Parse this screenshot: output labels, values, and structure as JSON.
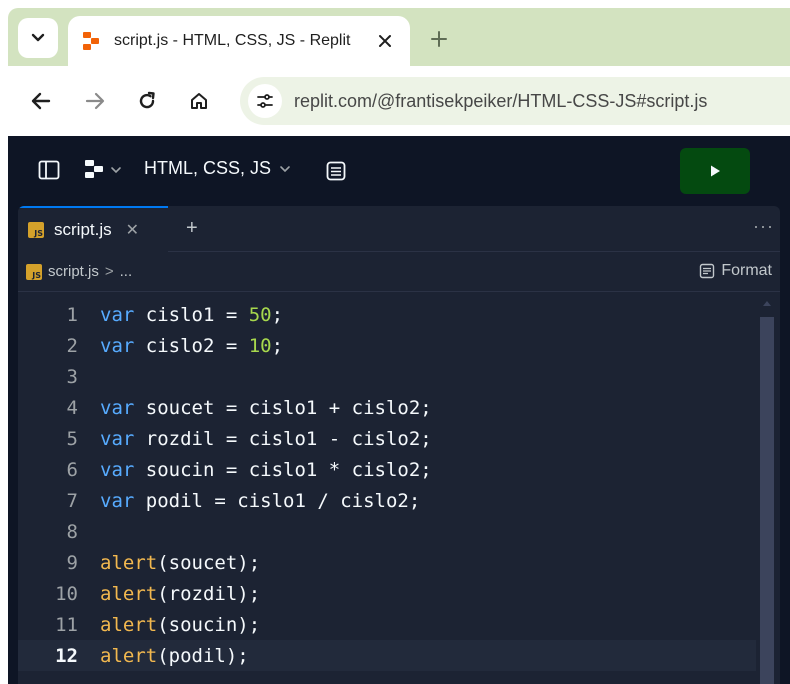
{
  "browser": {
    "tab_title": "script.js - HTML, CSS, JS - Replit",
    "url": "replit.com/@frantisekpeiker/HTML-CSS-JS#script.js"
  },
  "app": {
    "repl_name": "HTML, CSS, JS",
    "run_icon": "play-icon"
  },
  "editor": {
    "file_tab_label": "script.js",
    "file_tab_badge": "JS",
    "breadcrumb_file": "script.js",
    "breadcrumb_sep": ">",
    "breadcrumb_more": "...",
    "format_label": "Format",
    "active_line": 12,
    "lines": [
      {
        "num": "1",
        "tokens": [
          {
            "t": "kw",
            "v": "var"
          },
          {
            "t": "plain",
            "v": " cislo1 = "
          },
          {
            "t": "num",
            "v": "50"
          },
          {
            "t": "plain",
            "v": ";"
          }
        ]
      },
      {
        "num": "2",
        "tokens": [
          {
            "t": "kw",
            "v": "var"
          },
          {
            "t": "plain",
            "v": " cislo2 = "
          },
          {
            "t": "num",
            "v": "10"
          },
          {
            "t": "plain",
            "v": ";"
          }
        ]
      },
      {
        "num": "3",
        "tokens": []
      },
      {
        "num": "4",
        "tokens": [
          {
            "t": "kw",
            "v": "var"
          },
          {
            "t": "plain",
            "v": " soucet = cislo1 + cislo2;"
          }
        ]
      },
      {
        "num": "5",
        "tokens": [
          {
            "t": "kw",
            "v": "var"
          },
          {
            "t": "plain",
            "v": " rozdil = cislo1 - cislo2;"
          }
        ]
      },
      {
        "num": "6",
        "tokens": [
          {
            "t": "kw",
            "v": "var"
          },
          {
            "t": "plain",
            "v": " soucin = cislo1 * cislo2;"
          }
        ]
      },
      {
        "num": "7",
        "tokens": [
          {
            "t": "kw",
            "v": "var"
          },
          {
            "t": "plain",
            "v": " podil = cislo1 / cislo2;"
          }
        ]
      },
      {
        "num": "8",
        "tokens": []
      },
      {
        "num": "9",
        "tokens": [
          {
            "t": "fn",
            "v": "alert"
          },
          {
            "t": "plain",
            "v": "(soucet);"
          }
        ]
      },
      {
        "num": "10",
        "tokens": [
          {
            "t": "fn",
            "v": "alert"
          },
          {
            "t": "plain",
            "v": "(rozdil);"
          }
        ]
      },
      {
        "num": "11",
        "tokens": [
          {
            "t": "fn",
            "v": "alert"
          },
          {
            "t": "plain",
            "v": "(soucin);"
          }
        ]
      },
      {
        "num": "12",
        "tokens": [
          {
            "t": "fn",
            "v": "alert"
          },
          {
            "t": "plain",
            "v": "(podil);"
          }
        ]
      }
    ]
  },
  "colors": {
    "app_bg": "#0e1525",
    "editor_bg": "#1c2333",
    "keyword": "#57abff",
    "number": "#a7d84d",
    "function": "#f2b84f",
    "run_button": "#044a10",
    "tabstrip": "#d3e3c0"
  },
  "icons": {
    "tab_menu": "chevron-down-icon",
    "favicon": "replit-logo-icon",
    "tab_close": "close-icon",
    "new_tab": "plus-icon",
    "back": "arrow-left-icon",
    "forward": "arrow-right-icon",
    "reload": "reload-icon",
    "home": "home-icon",
    "site_info": "tune-icon",
    "sidebar_toggle": "sidebar-icon",
    "replit_menu": "replit-logo-icon",
    "repl_chevron": "chevron-down-icon",
    "repl_info": "info-card-icon",
    "format": "format-icon"
  }
}
